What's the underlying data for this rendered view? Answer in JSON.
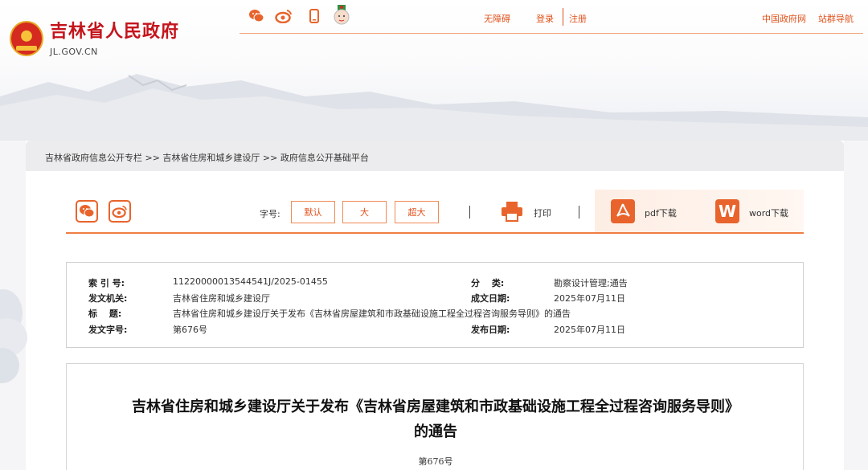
{
  "header": {
    "logo_title": "吉林省人民政府",
    "logo_sub": "JL.GOV.CN",
    "top_links": {
      "accessibility": "无障碍",
      "login": "登录",
      "register": "注册",
      "gov_cn": "中国政府网",
      "site_nav": "站群导航"
    }
  },
  "breadcrumb": {
    "text": "吉林省政府信息公开专栏 >> 吉林省住房和城乡建设厅 >> 政府信息公开基础平台"
  },
  "toolbar": {
    "font_size_label": "字号:",
    "font_sizes": [
      "默认",
      "大",
      "超大"
    ],
    "print": "打印",
    "pdf_download": "pdf下载",
    "word_download": "word下载",
    "word_icon_letter": "W"
  },
  "meta": {
    "index_no_label": "索 引 号:",
    "index_no": "11220000013544541J/2025-01455",
    "category_label": "分　 类:",
    "category": "勘察设计管理;通告",
    "issuer_label": "发文机关:",
    "issuer": "吉林省住房和城乡建设厅",
    "created_label": "成文日期:",
    "created": "2025年07月11日",
    "title_label": "标　 题:",
    "title": "吉林省住房和城乡建设厅关于发布《吉林省房屋建筑和市政基础设施工程全过程咨询服务导则》的通告",
    "doc_no_label": "发文字号:",
    "doc_no": "第676号",
    "published_label": "发布日期:",
    "published": "2025年07月11日"
  },
  "article": {
    "title_line1": "吉林省住房和城乡建设厅关于发布《吉林省房屋建筑和市政基础设施工程全过程咨询服务导则》",
    "title_line2": "的通告",
    "doc_no": "第676号"
  },
  "colors": {
    "accent": "#e8642c",
    "brand_red": "#c4141c"
  }
}
